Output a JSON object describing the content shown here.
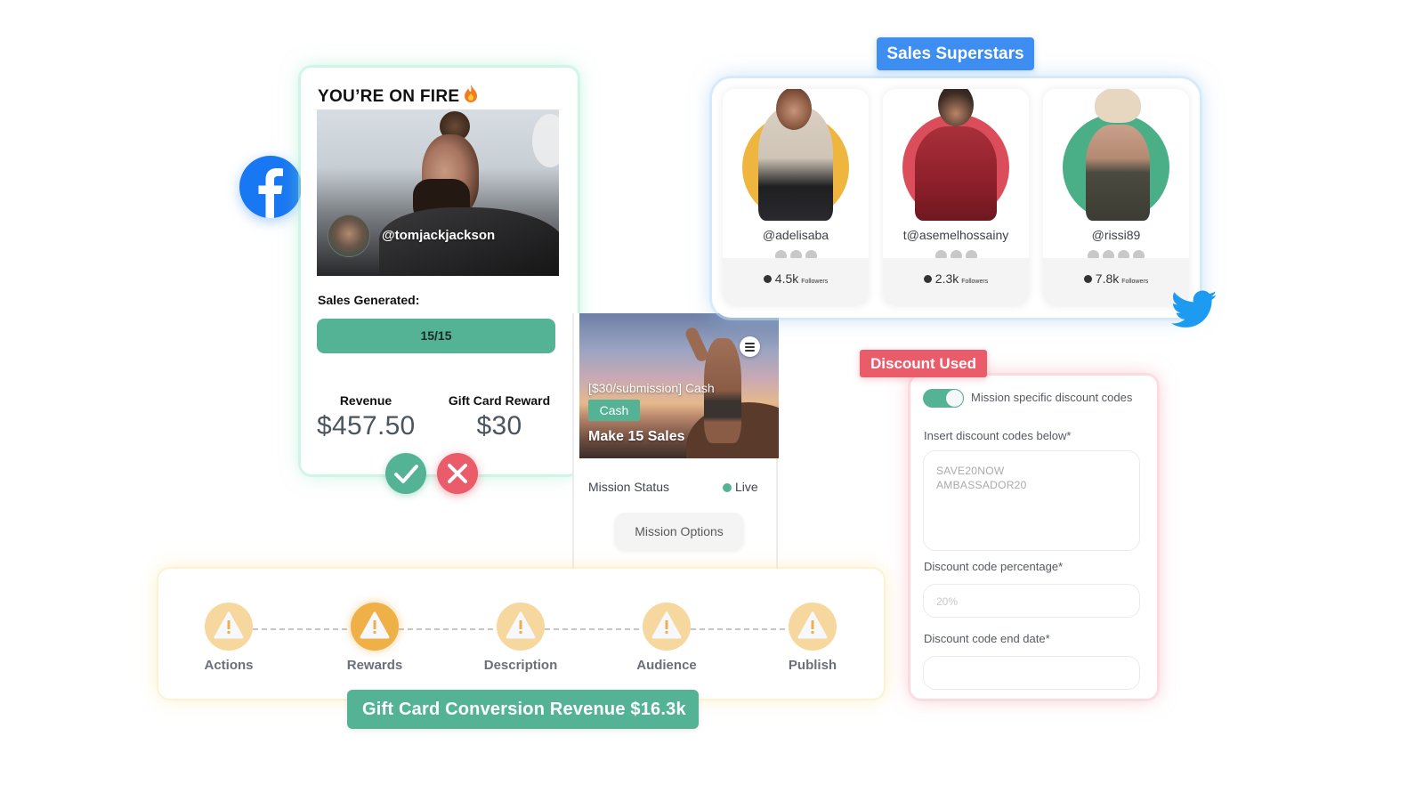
{
  "fire_card": {
    "title": "YOU’RE ON FIRE",
    "title_icon": "fire-icon",
    "handle": "@tomjackjackson",
    "sales_label": "Sales Generated:",
    "progress": {
      "current": 15,
      "total": 15,
      "text": "15/15",
      "fraction": 1.0
    },
    "revenue_label": "Revenue",
    "revenue_value": "$457.50",
    "gift_label": "Gift Card Reward",
    "gift_value": "$30",
    "approve_icon": "check-icon",
    "reject_icon": "x-icon"
  },
  "mission_card": {
    "subtitle": "[$30/submission] Cash",
    "badge": "Cash",
    "title": "Make 15 Sales",
    "status_label": "Mission Status",
    "status_value": "Live",
    "options_button": "Mission Options",
    "menu_icon": "hamburger-menu-icon"
  },
  "steps": {
    "items": [
      {
        "label": "Actions",
        "icon": "warning-icon",
        "active": false
      },
      {
        "label": "Rewards",
        "icon": "warning-icon",
        "active": true
      },
      {
        "label": "Description",
        "icon": "warning-icon",
        "active": false
      },
      {
        "label": "Audience",
        "icon": "warning-icon",
        "active": false
      },
      {
        "label": "Publish",
        "icon": "warning-icon",
        "active": false
      }
    ]
  },
  "gift_banner": "Gift Card Conversion Revenue $16.3k",
  "superstars": {
    "badge": "Sales Superstars",
    "people": [
      {
        "handle": "@adelisaba",
        "socials": [
          "instagram-icon",
          "snapchat-icon",
          "tiktok-icon"
        ],
        "followers": "4.5k",
        "followers_unit": "Followers",
        "color": "#efb63f"
      },
      {
        "handle": "t@asemelhossainy",
        "socials": [
          "instagram-icon",
          "facebook-icon",
          "twitter-icon"
        ],
        "followers": "2.3k",
        "followers_unit": "Followers",
        "color": "#dc4d5b"
      },
      {
        "handle": "@rissi89",
        "socials": [
          "instagram-icon",
          "facebook-icon",
          "tiktok-icon",
          "youtube-icon"
        ],
        "followers": "7.8k",
        "followers_unit": "Followers",
        "color": "#4aae86"
      }
    ]
  },
  "discount": {
    "badge": "Discount Used",
    "toggle_label": "Mission specific discount codes",
    "toggle_on": true,
    "codes_label": "Insert discount codes below*",
    "codes_value": "SAVE20NOW\nAMBASSADOR20",
    "pct_label": "Discount code percentage*",
    "pct_placeholder": "20%",
    "date_label": "Discount code end date*",
    "date_value": ""
  },
  "colors": {
    "green": "#53b394",
    "red": "#ea5c6a",
    "blue": "#3d8ef0",
    "orange": "#f0b048",
    "facebook": "#1877f2",
    "twitter": "#1d9bf0"
  }
}
